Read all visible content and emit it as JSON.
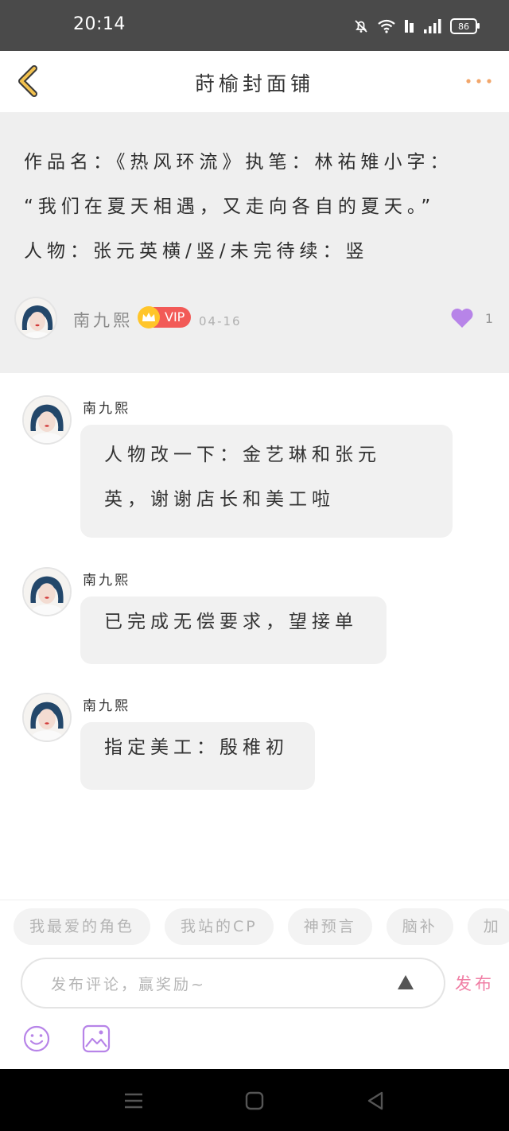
{
  "status": {
    "time": "20:14",
    "battery": "86"
  },
  "header": {
    "title": "莳榆封面铺"
  },
  "post": {
    "lines": [
      "作品名：《热风环流》执笔：林祐雉小字：",
      "“我们在夏天相遇，又走向各自的夏天。”",
      "人物：张元英横/竖/未完待续：竖"
    ],
    "author": "南九熙",
    "vip_label": "VIP",
    "date": "04-16",
    "likes": "1"
  },
  "comments": [
    {
      "author": "南九熙",
      "lines": [
        "人物改一下：金艺琳和张元",
        "英，谢谢店长和美工啦"
      ]
    },
    {
      "author": "南九熙",
      "lines": [
        "已完成无偿要求，望接单"
      ]
    },
    {
      "author": "南九熙",
      "lines": [
        "指定美工：殷稚初"
      ]
    }
  ],
  "tags": [
    "我最爱的角色",
    "我站的CP",
    "神预言",
    "脑补",
    "加"
  ],
  "composer": {
    "placeholder": "发布评论，赢奖励~",
    "publish_label": "发布"
  },
  "colors": {
    "accent": "#f07fa5",
    "like": "#b784e8",
    "vip": "#f25a57",
    "crown": "#ffc52a",
    "back_arrow": "#f2c14e"
  }
}
